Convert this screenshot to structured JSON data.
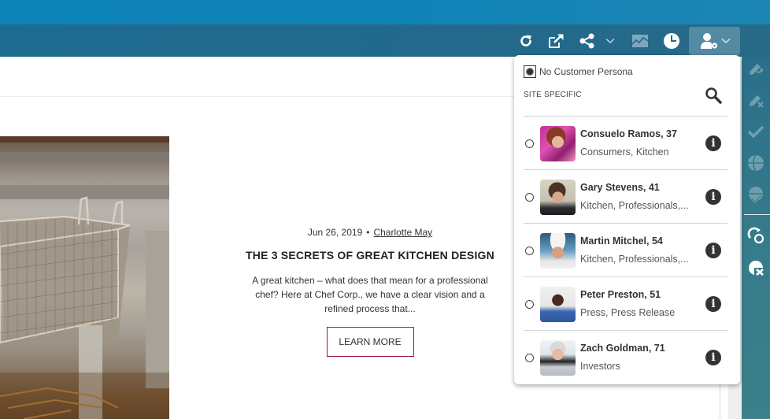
{
  "toolbar": {
    "buttons": [
      {
        "name": "refresh",
        "icon": "refresh-icon"
      },
      {
        "name": "open-external",
        "icon": "external-link-icon"
      },
      {
        "name": "share",
        "icon": "share-icon"
      },
      {
        "name": "share-menu",
        "icon": "chevron-down-icon"
      },
      {
        "name": "analytics",
        "icon": "chart-area-icon"
      },
      {
        "name": "timeline",
        "icon": "clock-pie-icon"
      },
      {
        "name": "persona",
        "icon": "user-gear-icon",
        "active": true
      },
      {
        "name": "persona-menu",
        "icon": "chevron-down-icon"
      }
    ]
  },
  "article": {
    "date": "Jun 26, 2019",
    "separator": "•",
    "author": "Charlotte May",
    "title": "THE 3 SECRETS OF GREAT KITCHEN DESIGN",
    "excerpt": "A great kitchen – what does that mean for a professional chef? Here at Chef Corp., we have a clear vision and a refined process that...",
    "button_label": "LEARN MORE",
    "image_alt": "stainless steel fryer basket in commercial kitchen"
  },
  "persona_dropdown": {
    "no_persona_label": "No Customer Persona",
    "no_persona_selected": true,
    "section_label": "SITE SPECIFIC",
    "search_icon": "search-icon",
    "personas": [
      {
        "name": "Consuelo Ramos, 37",
        "tags": "Consumers, Kitchen",
        "selected": false
      },
      {
        "name": "Gary Stevens, 41",
        "tags": "Kitchen, Professionals,...",
        "selected": false
      },
      {
        "name": "Martin Mitchel, 54",
        "tags": "Kitchen, Professionals,...",
        "selected": false
      },
      {
        "name": "Peter Preston, 51",
        "tags": "Press, Press Release",
        "selected": false
      },
      {
        "name": "Zach Goldman, 71",
        "tags": "Investors",
        "selected": false
      }
    ]
  },
  "side_rail": {
    "buttons": [
      {
        "name": "edit-redo",
        "icon": "pencil-redo-icon",
        "enabled": false
      },
      {
        "name": "edit-cancel",
        "icon": "pencil-x-icon",
        "enabled": false
      },
      {
        "name": "approve",
        "icon": "check-icon",
        "enabled": false
      },
      {
        "name": "publish",
        "icon": "globe-icon",
        "enabled": false
      },
      {
        "name": "publish-approved",
        "icon": "globe-check-icon",
        "enabled": false
      },
      {
        "name": "sync",
        "icon": "sync-icon",
        "enabled": true
      },
      {
        "name": "unpublish",
        "icon": "globe-x-icon",
        "enabled": true
      }
    ]
  },
  "colors": {
    "topbar": "#0c82b6",
    "toolbar": "#1e6b91",
    "rail": "#357b8a",
    "button_border": "#9b1b45"
  }
}
